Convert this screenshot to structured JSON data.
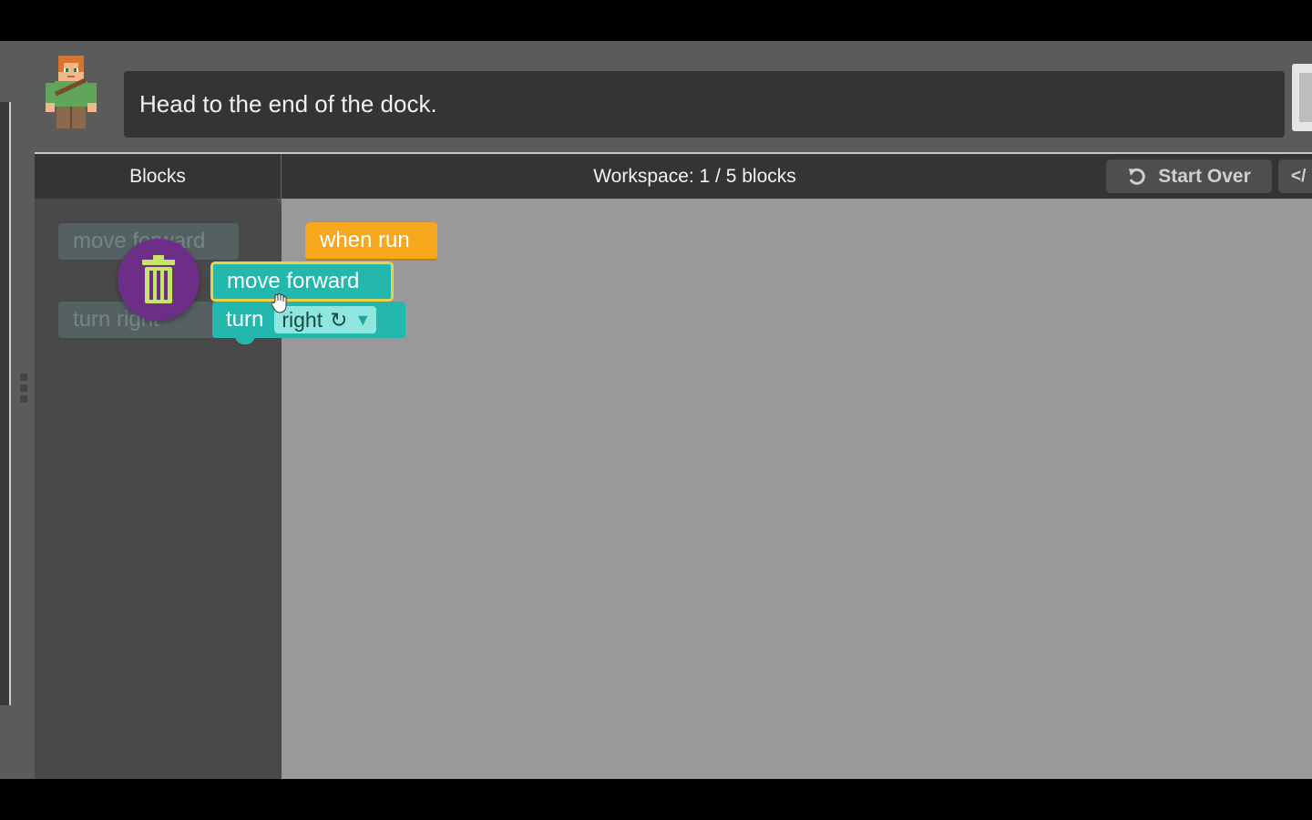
{
  "instruction": {
    "text": "Head to the end of the dock."
  },
  "panels": {
    "blocks_title": "Blocks",
    "workspace_title": "Workspace: 1 / 5 blocks"
  },
  "toolbar": {
    "start_over_label": "Start Over",
    "code_label": "</"
  },
  "toolbox": {
    "ghost_blocks": [
      "move forward",
      "turn right"
    ]
  },
  "workspace_blocks": {
    "when_run": "when run",
    "move_forward": "move forward",
    "turn_label": "turn",
    "turn_direction": "right",
    "turn_symbol": "↻",
    "dropdown_arrow": "▼"
  },
  "icons": {
    "trash": "trash-icon",
    "start_over": "undo-icon",
    "cursor": "hand-cursor-icon"
  },
  "colors": {
    "when_run": "#f7a71b",
    "block_teal": "#24b7ae",
    "highlight": "#e9d24a",
    "trash_bg": "#6d2e87"
  }
}
